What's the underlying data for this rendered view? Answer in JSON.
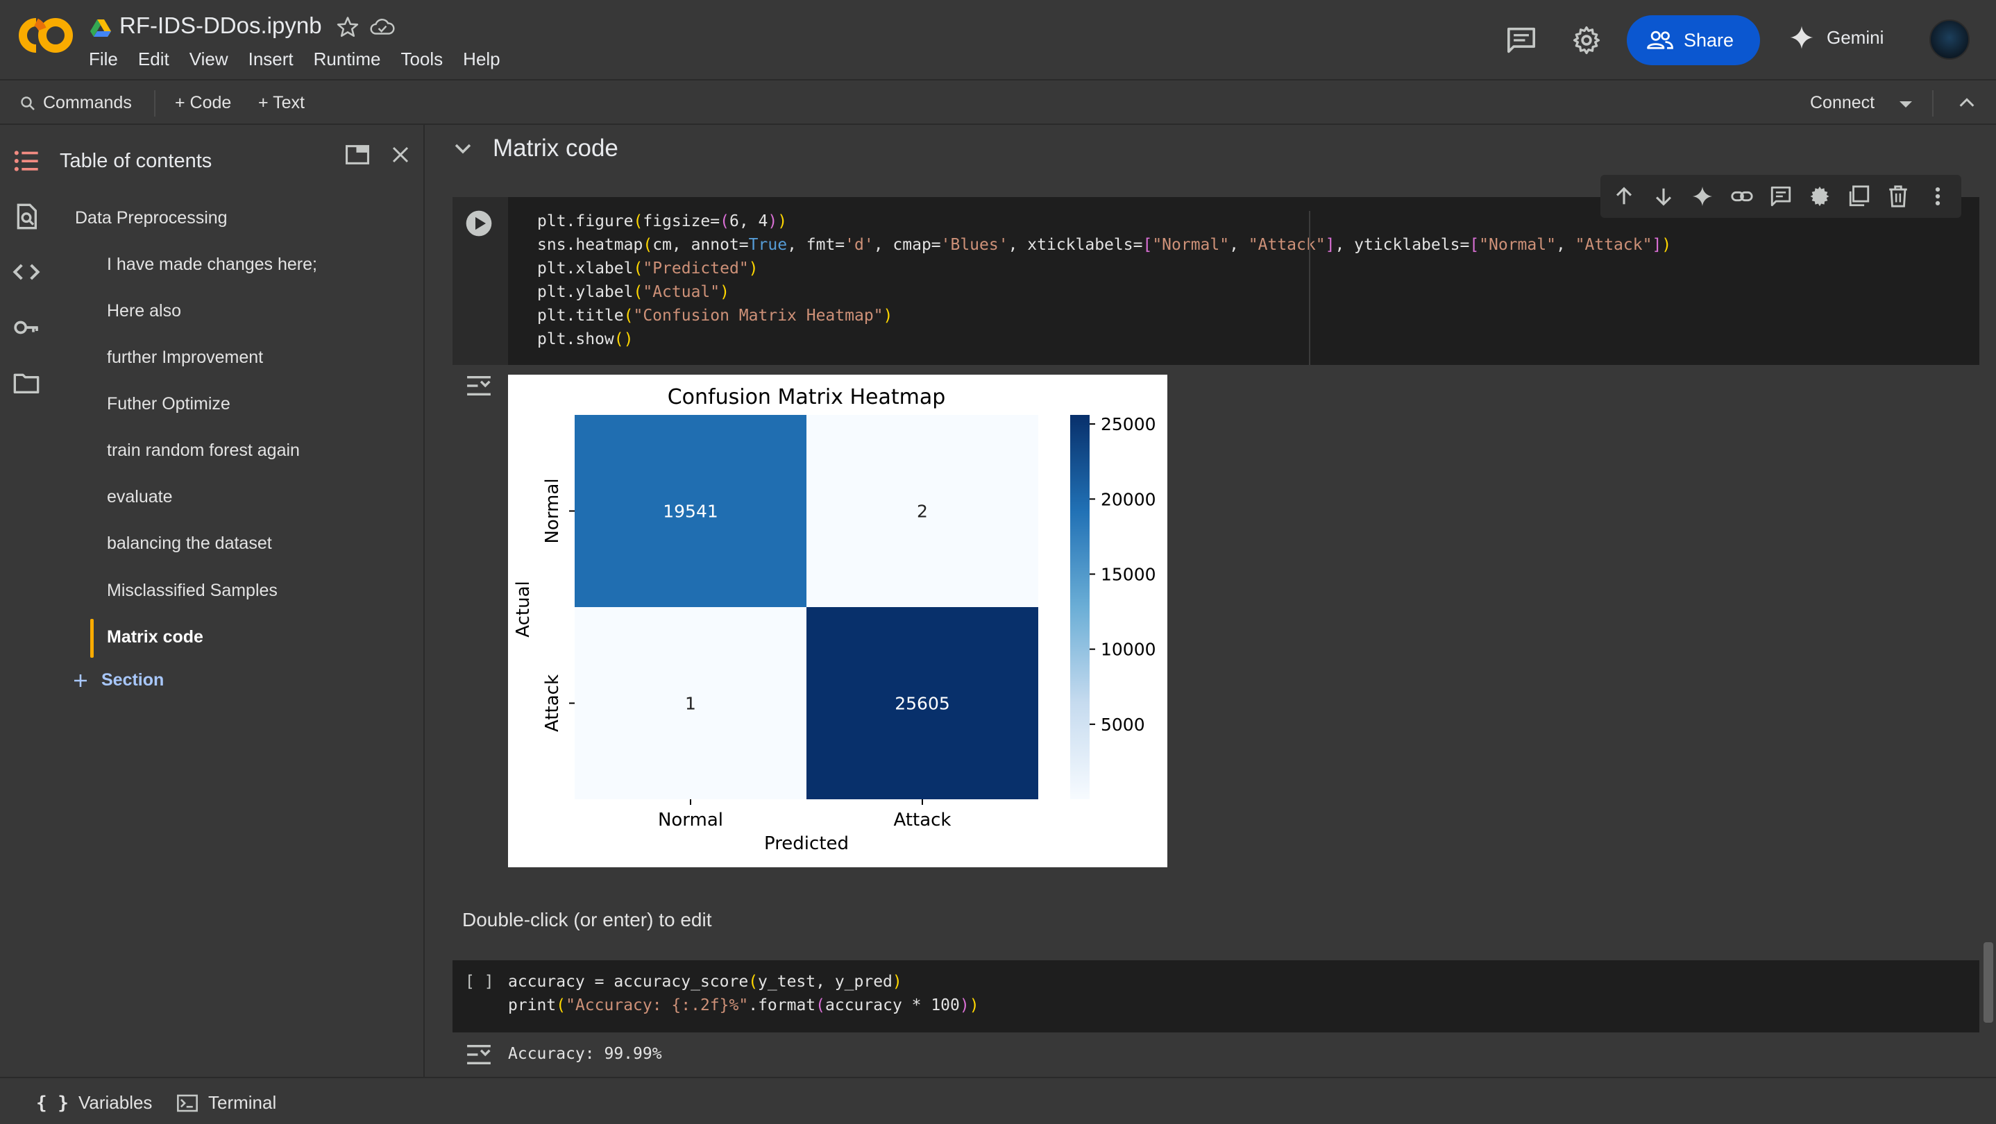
{
  "header": {
    "filename": "RF-IDS-DDos.ipynb",
    "menu": [
      "File",
      "Edit",
      "View",
      "Insert",
      "Runtime",
      "Tools",
      "Help"
    ],
    "share_label": "Share",
    "gemini_label": "Gemini"
  },
  "toolbar": {
    "commands_label": "Commands",
    "code_label": "+ Code",
    "text_label": "+ Text",
    "connect_label": "Connect"
  },
  "sidebar": {
    "title": "Table of contents",
    "items": [
      {
        "label": "Data Preprocessing",
        "level": 1
      },
      {
        "label": "I have made changes here;",
        "level": 2
      },
      {
        "label": "Here also",
        "level": 2
      },
      {
        "label": "further Improvement",
        "level": 2
      },
      {
        "label": "Futher Optimize",
        "level": 2
      },
      {
        "label": "train random forest again",
        "level": 2
      },
      {
        "label": "evaluate",
        "level": 2
      },
      {
        "label": "balancing the dataset",
        "level": 2
      },
      {
        "label": "Misclassified Samples",
        "level": 2
      },
      {
        "label": "Matrix code",
        "level": 2,
        "active": true
      }
    ],
    "add_section_label": "Section"
  },
  "notebook": {
    "section_title": "Matrix code",
    "markdown_text": "Double-click (or enter) to edit",
    "cell2_prompt": "[ ]",
    "cell2_output": "Accuracy: 99.99%"
  },
  "chart_data": {
    "type": "heatmap",
    "title": "Confusion Matrix Heatmap",
    "xlabel": "Predicted",
    "ylabel": "Actual",
    "x_categories": [
      "Normal",
      "Attack"
    ],
    "y_categories": [
      "Normal",
      "Attack"
    ],
    "values": [
      [
        19541,
        2
      ],
      [
        1,
        25605
      ]
    ],
    "colormap": "Blues",
    "colorbar_ticks": [
      5000,
      10000,
      15000,
      20000,
      25000
    ],
    "colorbar_range": [
      1,
      25605
    ]
  },
  "bottombar": {
    "variables_label": "Variables",
    "terminal_label": "Terminal"
  },
  "colors": {
    "accent": "#0b57d0",
    "active_marker": "#f9ab00",
    "link": "#a8c7fa"
  }
}
